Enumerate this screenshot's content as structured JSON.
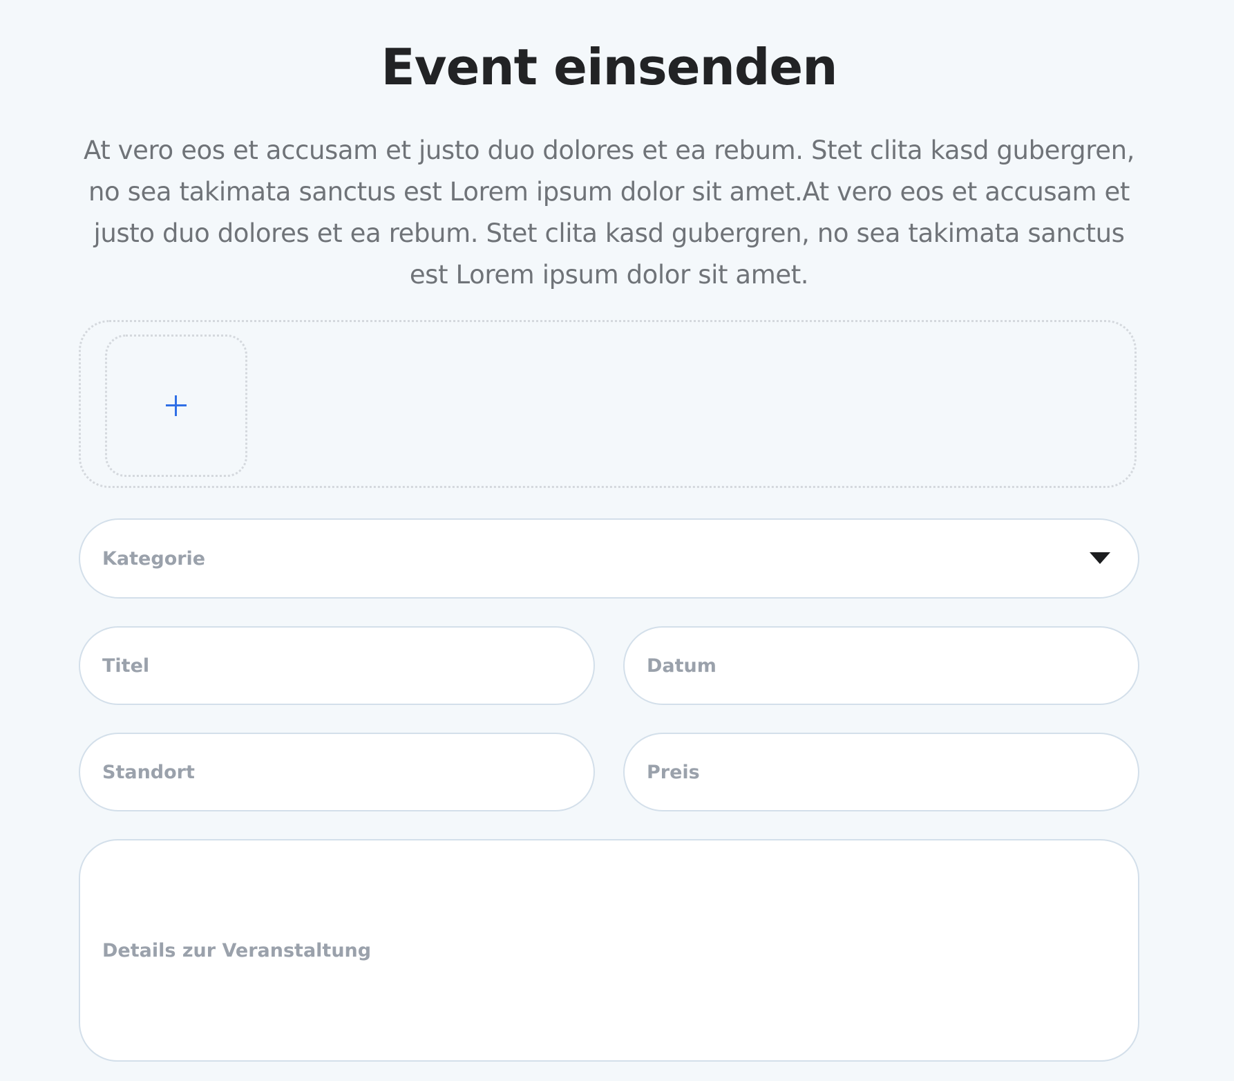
{
  "header": {
    "title": "Event einsenden",
    "intro": "At vero eos et accusam et justo duo dolores et ea rebum. Stet clita kasd gubergren, no sea takimata sanctus est Lorem ipsum dolor sit amet.At vero eos et accusam et justo duo dolores et ea rebum. Stet clita kasd gubergren, no sea takimata sanctus est Lorem ipsum dolor sit amet."
  },
  "upload": {
    "icon": "plus-icon"
  },
  "form": {
    "category_placeholder": "Kategorie",
    "title_placeholder": "Titel",
    "date_placeholder": "Datum",
    "location_placeholder": "Standort",
    "price_placeholder": "Preis",
    "details_placeholder": "Details zur Veranstaltung"
  },
  "colors": {
    "background": "#f4f8fb",
    "accent": "#2f6fe6",
    "title": "#222325",
    "body_text": "#6f7378",
    "placeholder": "#9aa1ab",
    "field_border": "#d3dfea"
  }
}
